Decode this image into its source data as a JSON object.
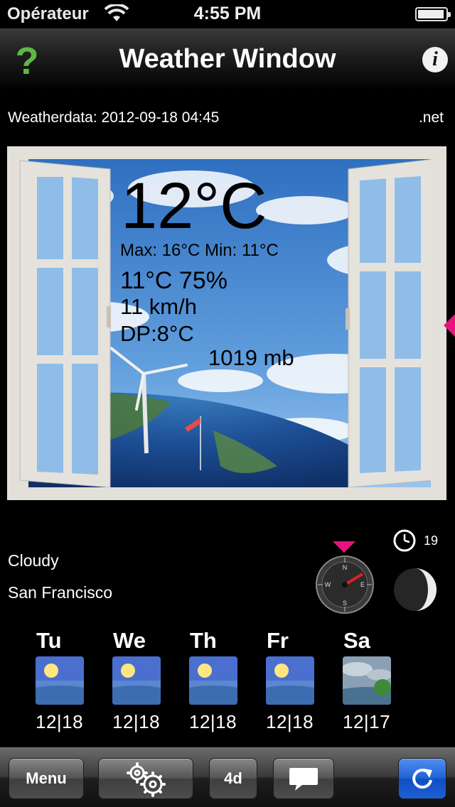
{
  "status_bar": {
    "carrier": "Opérateur",
    "time": "4:55 PM"
  },
  "nav": {
    "help_label": "?",
    "title": "Weather Window",
    "info_label": "i"
  },
  "meta": {
    "weatherdata": "Weatherdata: 2012-09-18 04:45",
    "source_suffix": ".net"
  },
  "current": {
    "temperature": "12°C",
    "max_min": "Max: 16°C  Min: 11°C",
    "temp_humidity": "11°C 75%",
    "wind": "11 km/h",
    "dew_point": "DP:8°C",
    "pressure": "1019 mb"
  },
  "condition": {
    "text": "Cloudy",
    "city": "San Francisco",
    "moon_age": "19"
  },
  "compass": {
    "letters": [
      "N",
      "E",
      "S",
      "W"
    ]
  },
  "forecast": [
    {
      "day": "Tu",
      "temps": "12|18",
      "icon": "sunny-icon"
    },
    {
      "day": "We",
      "temps": "12|18",
      "icon": "sunny-icon"
    },
    {
      "day": "Th",
      "temps": "12|18",
      "icon": "sunny-icon"
    },
    {
      "day": "Fr",
      "temps": "12|18",
      "icon": "sunny-icon"
    },
    {
      "day": "Sa",
      "temps": "12|17",
      "icon": "cloudy-landscape-icon"
    }
  ],
  "toolbar": {
    "menu_label": "Menu",
    "settings_icon": "gears-icon",
    "days_label": "4d",
    "message_icon": "speech-bubble-icon",
    "refresh_icon": "refresh-icon"
  },
  "colors": {
    "accent_pink": "#e7137f",
    "help_green": "#5fb843",
    "refresh_blue": "#2062d6"
  }
}
